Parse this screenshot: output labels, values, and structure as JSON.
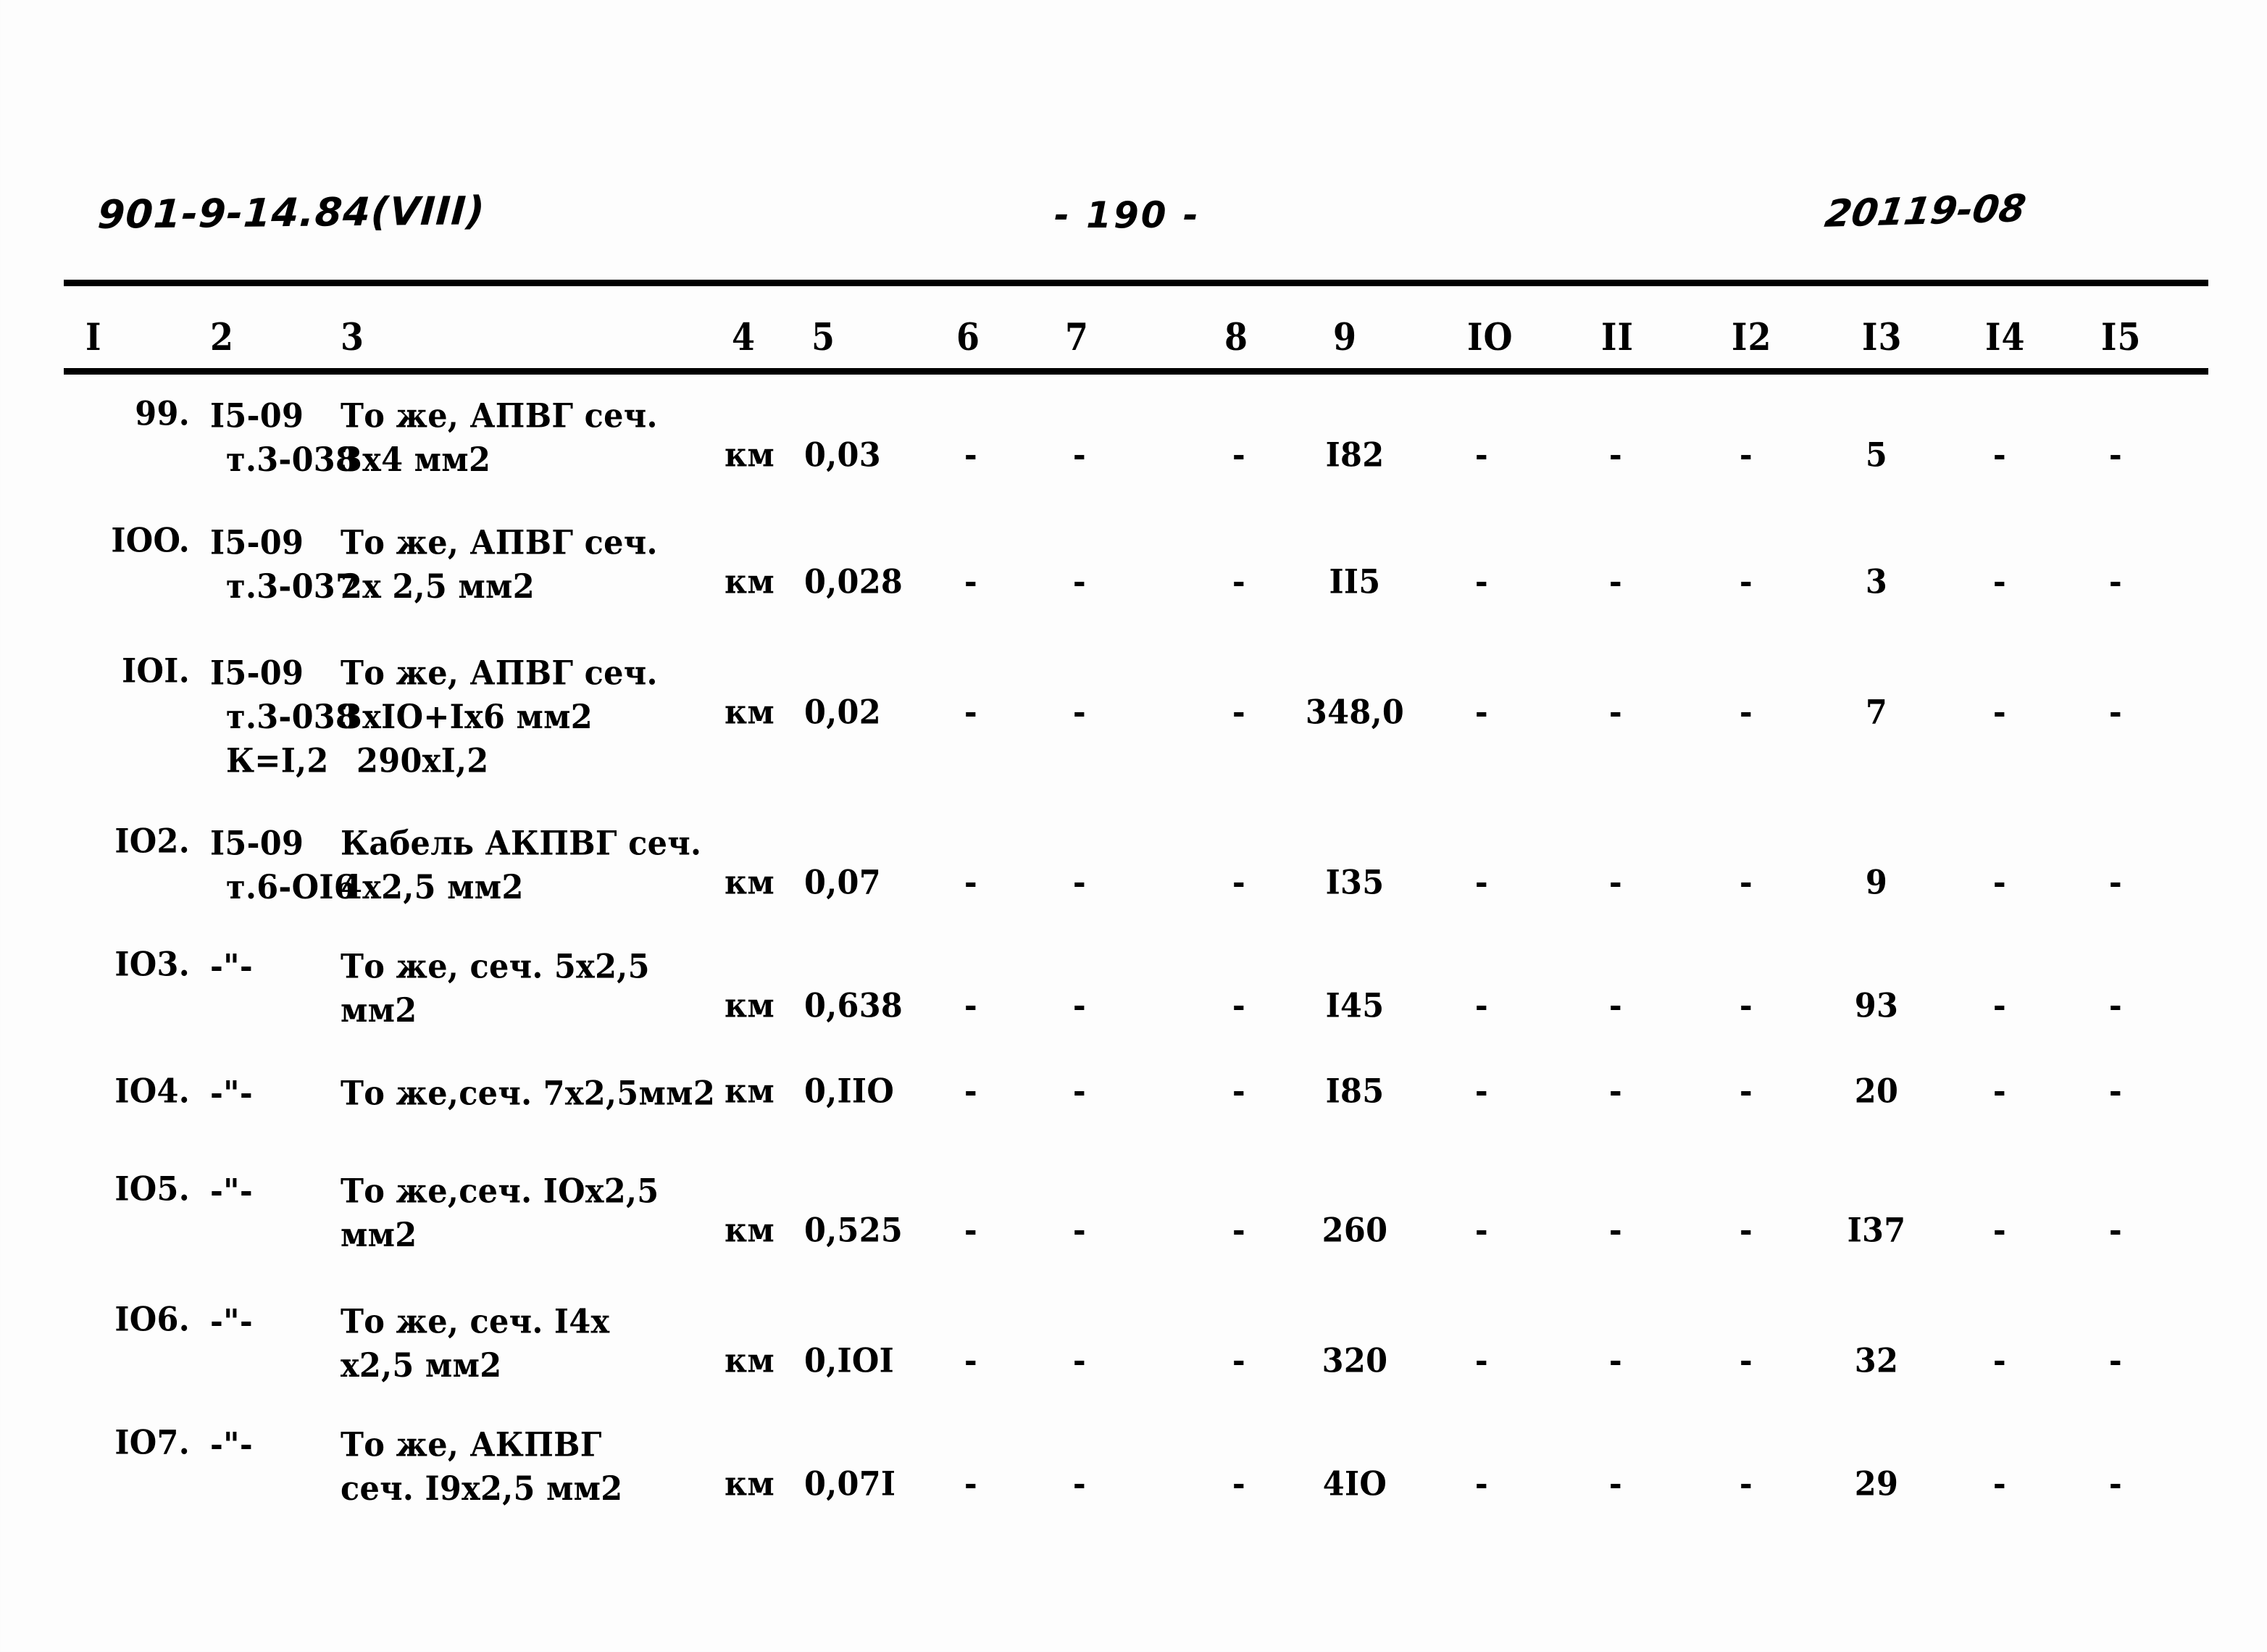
{
  "header": {
    "left_code": "901-9-14.84(VIII)",
    "page_number": "- 190 -",
    "right_code": "20119-08"
  },
  "table": {
    "column_headers": [
      "I",
      "2",
      "3",
      "4",
      "5",
      "6",
      "7",
      "8",
      "9",
      "IO",
      "II",
      "I2",
      "I3",
      "I4",
      "I5"
    ],
    "dash_mark": "-",
    "ditto_mark": "-\"-",
    "rows": [
      {
        "num": "99.",
        "col2": [
          "I5-09",
          "т.3-038"
        ],
        "col3": [
          "То же, АПВГ сеч.",
          "3х4 мм2"
        ],
        "col4": "км",
        "col5": "0,03",
        "col6": "-",
        "col7": "-",
        "col8": "-",
        "col9": "I82",
        "col10": "-",
        "col11": "-",
        "col12": "-",
        "col13": "5",
        "col14": "-",
        "col15": "-"
      },
      {
        "num": "IOO.",
        "col2": [
          "I5-09",
          "т.3-037"
        ],
        "col3": [
          "То же, АПВГ сеч.",
          "2х 2,5 мм2"
        ],
        "col4": "км",
        "col5": "0,028",
        "col6": "-",
        "col7": "-",
        "col8": "-",
        "col9": "II5",
        "col10": "-",
        "col11": "-",
        "col12": "-",
        "col13": "3",
        "col14": "-",
        "col15": "-"
      },
      {
        "num": "IOI.",
        "col2": [
          "I5-09",
          "т.3-038",
          "К=I,2"
        ],
        "col3": [
          "То же, АПВГ сеч.",
          "3хIO+Iх6 мм2",
          "290хI,2"
        ],
        "col4": "км",
        "col5": "0,02",
        "col6": "-",
        "col7": "-",
        "col8": "-",
        "col9": "348,0",
        "col10": "-",
        "col11": "-",
        "col12": "-",
        "col13": "7",
        "col14": "-",
        "col15": "-"
      },
      {
        "num": "IO2.",
        "col2": [
          "I5-09",
          "т.6-OI6"
        ],
        "col3": [
          "Кабель АКПВГ сеч.",
          "4х2,5 мм2"
        ],
        "col4": "км",
        "col5": "0,07",
        "col6": "-",
        "col7": "-",
        "col8": "-",
        "col9": "I35",
        "col10": "-",
        "col11": "-",
        "col12": "-",
        "col13": "9",
        "col14": "-",
        "col15": "-"
      },
      {
        "num": "IO3.",
        "col2": [
          "-\"-"
        ],
        "col3": [
          "То же, сеч. 5х2,5",
          "мм2"
        ],
        "col4": "км",
        "col5": "0,638",
        "col6": "-",
        "col7": "-",
        "col8": "-",
        "col9": "I45",
        "col10": "-",
        "col11": "-",
        "col12": "-",
        "col13": "93",
        "col14": "-",
        "col15": "-"
      },
      {
        "num": "IO4.",
        "col2": [
          "-\"-"
        ],
        "col3": [
          "То же,сеч. 7х2,5мм2"
        ],
        "col4": "км",
        "col5": "0,IIO",
        "col6": "-",
        "col7": "-",
        "col8": "-",
        "col9": "I85",
        "col10": "-",
        "col11": "-",
        "col12": "-",
        "col13": "20",
        "col14": "-",
        "col15": "-"
      },
      {
        "num": "IO5.",
        "col2": [
          "-\"-"
        ],
        "col3": [
          "То же,сеч. IOх2,5",
          "мм2"
        ],
        "col4": "км",
        "col5": "0,525",
        "col6": "-",
        "col7": "-",
        "col8": "-",
        "col9": "260",
        "col10": "-",
        "col11": "-",
        "col12": "-",
        "col13": "I37",
        "col14": "-",
        "col15": "-"
      },
      {
        "num": "IO6.",
        "col2": [
          "-\"-"
        ],
        "col3": [
          "То же, сеч. I4х",
          "х2,5 мм2"
        ],
        "col4": "км",
        "col5": "0,IOI",
        "col6": "-",
        "col7": "-",
        "col8": "-",
        "col9": "320",
        "col10": "-",
        "col11": "-",
        "col12": "-",
        "col13": "32",
        "col14": "-",
        "col15": "-"
      },
      {
        "num": "IO7.",
        "col2": [
          "-\"-"
        ],
        "col3": [
          "То же, АКПВГ",
          "сеч. I9х2,5 мм2"
        ],
        "col4": "км",
        "col5": "0,07I",
        "col6": "-",
        "col7": "-",
        "col8": "-",
        "col9": "4IO",
        "col10": "-",
        "col11": "-",
        "col12": "-",
        "col13": "29",
        "col14": "-",
        "col15": "-"
      }
    ]
  }
}
